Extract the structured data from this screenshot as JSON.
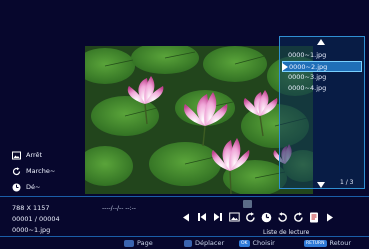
{
  "photo": {
    "subject": "lotus flowers on lily pads"
  },
  "playlist": {
    "items": [
      "0000~1.jpg",
      "0000~2.jpg",
      "0000~3.jpg",
      "0000~4.jpg"
    ],
    "selected_index": 1,
    "page_indicator": "1 / 3",
    "label": "Liste de lecture"
  },
  "status": {
    "slideshow": "Arrêt",
    "repeat": "Marche~",
    "timer": "Dé~"
  },
  "info": {
    "resolution": "788 X 1157",
    "index": "00001 / 00004",
    "filename": "0000~1.jpg",
    "date_time": "----/--/--  --:--"
  },
  "controls": {
    "icons": [
      "prev-arrow-icon",
      "skip-back-icon",
      "skip-forward-icon",
      "slideshow-icon",
      "repeat-icon",
      "timer-icon",
      "rotate-left-icon",
      "rotate-right-icon",
      "info-icon",
      "next-arrow-icon"
    ]
  },
  "footer": {
    "page_label": "Page",
    "move_label": "Déplacer",
    "ok_key": "OK",
    "choose_label": "Choisir",
    "return_key": "RETURN",
    "back_label": "Retour"
  },
  "colors": {
    "background": "#07072d",
    "panel_border": "#2f8fd2",
    "selection": "#1f6fb8",
    "accent": "#2f7ad8"
  }
}
